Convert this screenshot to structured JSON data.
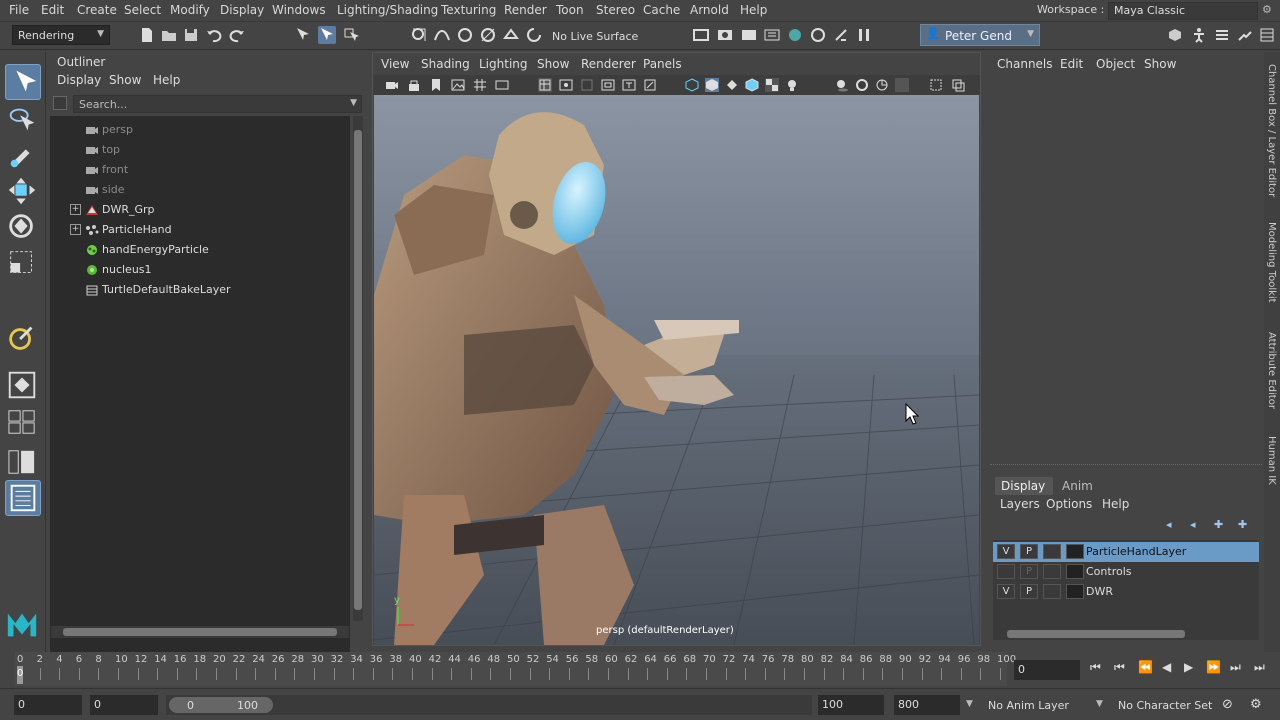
{
  "menu": {
    "items": [
      "File",
      "Edit",
      "Create",
      "Select",
      "Modify",
      "Display",
      "Windows",
      "Lighting/Shading",
      "Texturing",
      "Render",
      "Toon",
      "Stereo",
      "Cache",
      "Arnold",
      "Help"
    ],
    "workspace_label": "Workspace :",
    "workspace_value": "Maya Classic"
  },
  "status": {
    "menuset": "Rendering",
    "live_surface": "No Live Surface",
    "user": "Peter Gend"
  },
  "outliner": {
    "title": "Outliner",
    "menus": [
      "Display",
      "Show",
      "Help"
    ],
    "search_placeholder": "Search...",
    "items": [
      {
        "label": "persp",
        "dim": true,
        "icon": "camera-icon"
      },
      {
        "label": "top",
        "dim": true,
        "icon": "camera-icon"
      },
      {
        "label": "front",
        "dim": true,
        "icon": "camera-icon"
      },
      {
        "label": "side",
        "dim": true,
        "icon": "camera-icon"
      },
      {
        "label": "DWR_Grp",
        "dim": false,
        "icon": "group-icon",
        "expand": "+"
      },
      {
        "label": "ParticleHand",
        "dim": false,
        "icon": "particle-icon",
        "expand": "+"
      },
      {
        "label": "handEnergyParticle",
        "dim": false,
        "icon": "nparticle-icon"
      },
      {
        "label": "nucleus1",
        "dim": false,
        "icon": "nucleus-icon"
      },
      {
        "label": "TurtleDefaultBakeLayer",
        "dim": false,
        "icon": "bake-layer-icon"
      }
    ]
  },
  "viewport": {
    "menus": [
      "View",
      "Shading",
      "Lighting",
      "Show",
      "Renderer",
      "Panels"
    ],
    "camera_label": "persp (defaultRenderLayer)",
    "axis_y": "y"
  },
  "channelbox": {
    "menus": [
      "Channels",
      "Edit",
      "Object",
      "Show"
    ]
  },
  "layereditor": {
    "tabs": [
      "Display",
      "Anim"
    ],
    "menus": [
      "Layers",
      "Options",
      "Help"
    ],
    "layers": [
      {
        "v": "V",
        "p": "P",
        "name": "ParticleHandLayer",
        "selected": true
      },
      {
        "v": "",
        "p": "P",
        "name": "Controls",
        "selected": false
      },
      {
        "v": "V",
        "p": "P",
        "name": "DWR",
        "selected": false
      }
    ]
  },
  "sidetabs": [
    "Channel Box / Layer Editor",
    "Modeling Toolkit",
    "Attribute Editor",
    "Human IK"
  ],
  "timeline": {
    "ticks": [
      "0",
      "2",
      "4",
      "6",
      "8",
      "10",
      "12",
      "14",
      "16",
      "18",
      "20",
      "22",
      "24",
      "26",
      "28",
      "30",
      "32",
      "34",
      "36",
      "38",
      "40",
      "42",
      "44",
      "46",
      "48",
      "50",
      "52",
      "54",
      "56",
      "58",
      "60",
      "62",
      "64",
      "66",
      "68",
      "70",
      "72",
      "74",
      "76",
      "78",
      "80",
      "82",
      "84",
      "86",
      "88",
      "90",
      "92",
      "94",
      "96",
      "98",
      "100"
    ],
    "current_frame": "0",
    "cursor_label": "0"
  },
  "range": {
    "start": "0",
    "start2": "0",
    "slider_start": "0",
    "slider_end": "100",
    "end": "100",
    "end2": "800",
    "anim_layer": "No Anim Layer",
    "char_set": "No Character Set"
  }
}
